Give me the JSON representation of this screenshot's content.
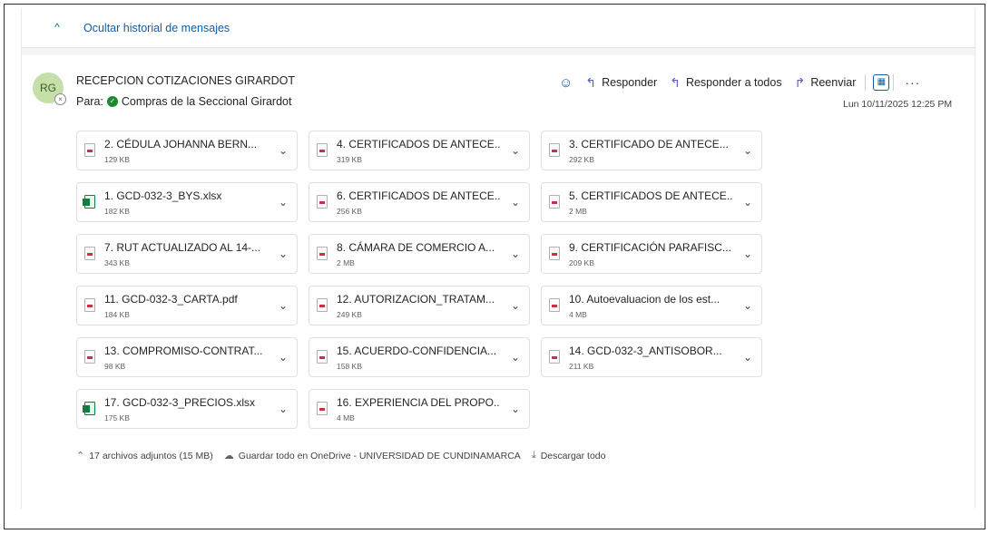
{
  "history": {
    "toggle_label": "Ocultar historial de mensajes"
  },
  "message": {
    "avatar_initials": "RG",
    "sender": "RECEPCION COTIZACIONES GIRARDOT",
    "to_label": "Para:",
    "to_name": "Compras de la Seccional Girardot",
    "date": "Lun 10/11/2025 12:25 PM"
  },
  "actions": {
    "reply": "Responder",
    "reply_all": "Responder a todos",
    "forward": "Reenviar"
  },
  "attachments": [
    {
      "name": "2. CÉDULA JOHANNA BERN...",
      "size": "129 KB",
      "type": "pdf"
    },
    {
      "name": "4. CERTIFICADOS DE ANTECE...",
      "size": "319 KB",
      "type": "pdf"
    },
    {
      "name": "3. CERTIFICADO DE ANTECE...",
      "size": "292 KB",
      "type": "pdf"
    },
    {
      "name": "1. GCD-032-3_BYS.xlsx",
      "size": "182 KB",
      "type": "xlsx"
    },
    {
      "name": "6. CERTIFICADOS DE ANTECE...",
      "size": "256 KB",
      "type": "pdf"
    },
    {
      "name": "5. CERTIFICADOS DE ANTECE...",
      "size": "2 MB",
      "type": "pdf"
    },
    {
      "name": "7. RUT ACTUALIZADO AL 14-...",
      "size": "343 KB",
      "type": "pdf"
    },
    {
      "name": "8. CÁMARA DE COMERCIO A...",
      "size": "2 MB",
      "type": "pdf"
    },
    {
      "name": "9. CERTIFICACIÓN PARAFISC...",
      "size": "209 KB",
      "type": "pdf"
    },
    {
      "name": "11. GCD-032-3_CARTA.pdf",
      "size": "184 KB",
      "type": "pdf"
    },
    {
      "name": "12. AUTORIZACION_TRATAM...",
      "size": "249 KB",
      "type": "pdf"
    },
    {
      "name": "10. Autoevaluacion de los est...",
      "size": "4 MB",
      "type": "pdf"
    },
    {
      "name": "13. COMPROMISO-CONTRAT...",
      "size": "98 KB",
      "type": "pdf"
    },
    {
      "name": "15. ACUERDO-CONFIDENCIA...",
      "size": "158 KB",
      "type": "pdf"
    },
    {
      "name": "14. GCD-032-3_ANTISOBOR...",
      "size": "211 KB",
      "type": "pdf"
    },
    {
      "name": "17. GCD-032-3_PRECIOS.xlsx",
      "size": "175 KB",
      "type": "xlsx"
    },
    {
      "name": "16. EXPERIENCIA DEL PROPO...",
      "size": "4 MB",
      "type": "pdf"
    }
  ],
  "footer": {
    "count": "17 archivos adjuntos (15 MB)",
    "save_onedrive": "Guardar todo en OneDrive - UNIVERSIDAD DE CUNDINAMARCA",
    "download_all": "Descargar todo"
  }
}
